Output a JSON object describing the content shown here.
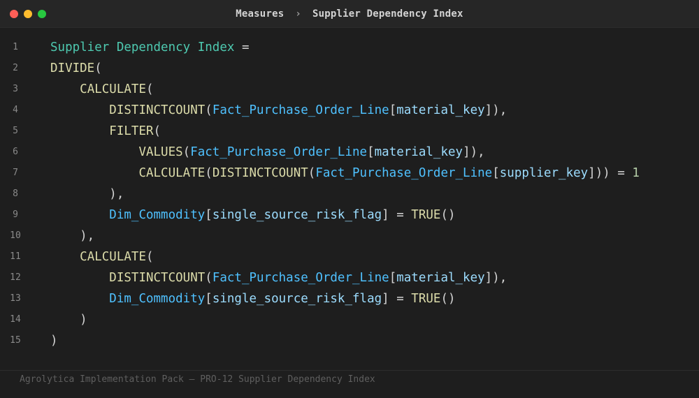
{
  "window": {
    "controls": {
      "close_color": "#ff5f57",
      "minimize_color": "#febc2e",
      "maximize_color": "#28c840"
    }
  },
  "breadcrumb": {
    "parent": "Measures",
    "separator": "›",
    "current": "Supplier Dependency Index"
  },
  "colors": {
    "background": "#1e1e1e",
    "measure": "#4ec9b0",
    "function": "#dcdcaa",
    "table": "#4fc1ff",
    "column": "#9cdcfe",
    "punctuation": "#d4d4d4",
    "number": "#b5cea8"
  },
  "code": {
    "lines": [
      {
        "num": "1",
        "tokens": [
          {
            "t": "Supplier Dependency Index",
            "c": "measure"
          },
          {
            "t": " =",
            "c": "punc"
          }
        ]
      },
      {
        "num": "2",
        "tokens": [
          {
            "t": "DIVIDE",
            "c": "fn"
          },
          {
            "t": "(",
            "c": "punc"
          }
        ]
      },
      {
        "num": "3",
        "tokens": [
          {
            "t": "    ",
            "c": "punc"
          },
          {
            "t": "CALCULATE",
            "c": "fn"
          },
          {
            "t": "(",
            "c": "punc"
          }
        ]
      },
      {
        "num": "4",
        "tokens": [
          {
            "t": "        ",
            "c": "punc"
          },
          {
            "t": "DISTINCTCOUNT",
            "c": "fn"
          },
          {
            "t": "(",
            "c": "punc"
          },
          {
            "t": "Fact_Purchase_Order_Line",
            "c": "table"
          },
          {
            "t": "[",
            "c": "punc"
          },
          {
            "t": "material_key",
            "c": "col"
          },
          {
            "t": "]),",
            "c": "punc"
          }
        ]
      },
      {
        "num": "5",
        "tokens": [
          {
            "t": "        ",
            "c": "punc"
          },
          {
            "t": "FILTER",
            "c": "fn"
          },
          {
            "t": "(",
            "c": "punc"
          }
        ]
      },
      {
        "num": "6",
        "tokens": [
          {
            "t": "            ",
            "c": "punc"
          },
          {
            "t": "VALUES",
            "c": "fn"
          },
          {
            "t": "(",
            "c": "punc"
          },
          {
            "t": "Fact_Purchase_Order_Line",
            "c": "table"
          },
          {
            "t": "[",
            "c": "punc"
          },
          {
            "t": "material_key",
            "c": "col"
          },
          {
            "t": "]),",
            "c": "punc"
          }
        ]
      },
      {
        "num": "7",
        "tokens": [
          {
            "t": "            ",
            "c": "punc"
          },
          {
            "t": "CALCULATE",
            "c": "fn"
          },
          {
            "t": "(",
            "c": "punc"
          },
          {
            "t": "DISTINCTCOUNT",
            "c": "fn"
          },
          {
            "t": "(",
            "c": "punc"
          },
          {
            "t": "Fact_Purchase_Order_Line",
            "c": "table"
          },
          {
            "t": "[",
            "c": "punc"
          },
          {
            "t": "supplier_key",
            "c": "col"
          },
          {
            "t": "])) = ",
            "c": "punc"
          },
          {
            "t": "1",
            "c": "num"
          }
        ]
      },
      {
        "num": "8",
        "tokens": [
          {
            "t": "        ),",
            "c": "punc"
          }
        ]
      },
      {
        "num": "9",
        "tokens": [
          {
            "t": "        ",
            "c": "punc"
          },
          {
            "t": "Dim_Commodity",
            "c": "table"
          },
          {
            "t": "[",
            "c": "punc"
          },
          {
            "t": "single_source_risk_flag",
            "c": "col"
          },
          {
            "t": "] = ",
            "c": "punc"
          },
          {
            "t": "TRUE",
            "c": "fn"
          },
          {
            "t": "()",
            "c": "punc"
          }
        ]
      },
      {
        "num": "10",
        "tokens": [
          {
            "t": "    ),",
            "c": "punc"
          }
        ]
      },
      {
        "num": "11",
        "tokens": [
          {
            "t": "    ",
            "c": "punc"
          },
          {
            "t": "CALCULATE",
            "c": "fn"
          },
          {
            "t": "(",
            "c": "punc"
          }
        ]
      },
      {
        "num": "12",
        "tokens": [
          {
            "t": "        ",
            "c": "punc"
          },
          {
            "t": "DISTINCTCOUNT",
            "c": "fn"
          },
          {
            "t": "(",
            "c": "punc"
          },
          {
            "t": "Fact_Purchase_Order_Line",
            "c": "table"
          },
          {
            "t": "[",
            "c": "punc"
          },
          {
            "t": "material_key",
            "c": "col"
          },
          {
            "t": "]),",
            "c": "punc"
          }
        ]
      },
      {
        "num": "13",
        "tokens": [
          {
            "t": "        ",
            "c": "punc"
          },
          {
            "t": "Dim_Commodity",
            "c": "table"
          },
          {
            "t": "[",
            "c": "punc"
          },
          {
            "t": "single_source_risk_flag",
            "c": "col"
          },
          {
            "t": "] = ",
            "c": "punc"
          },
          {
            "t": "TRUE",
            "c": "fn"
          },
          {
            "t": "()",
            "c": "punc"
          }
        ]
      },
      {
        "num": "14",
        "tokens": [
          {
            "t": "    )",
            "c": "punc"
          }
        ]
      },
      {
        "num": "15",
        "tokens": [
          {
            "t": ")",
            "c": "punc"
          }
        ]
      }
    ]
  },
  "footer": {
    "text": "Agrolytica Implementation Pack — PRO-12 Supplier Dependency Index"
  }
}
